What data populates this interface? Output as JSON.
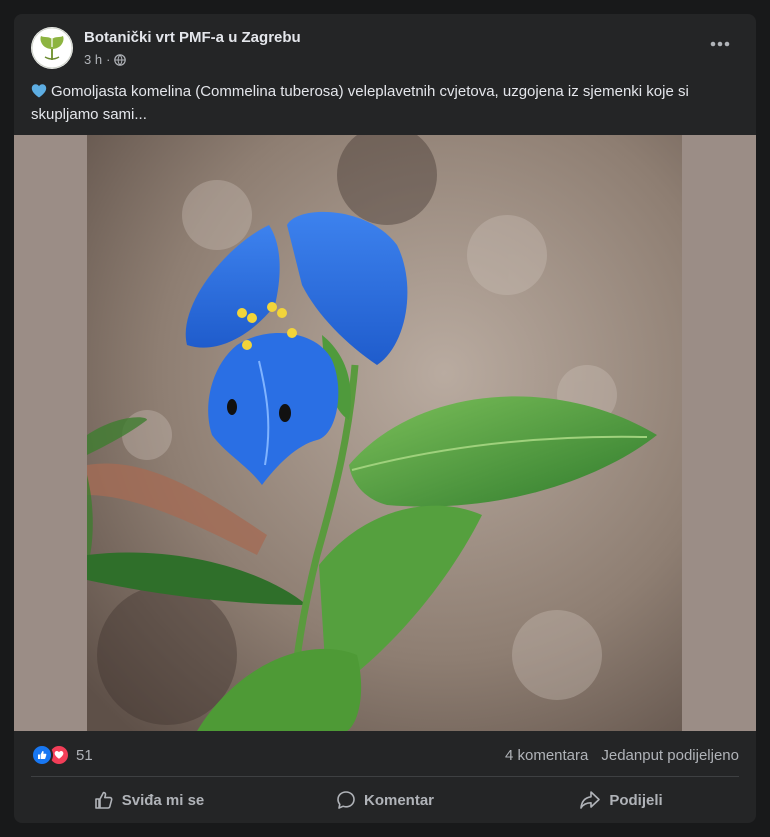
{
  "post": {
    "page_name": "Botanički vrt PMF-a u Zagrebu",
    "time": "3 h",
    "privacy_icon": "globe-icon",
    "more_icon": "more-dots-icon",
    "text_emoji_icon": "blue-heart-icon",
    "text": "Gomoljasta komelina (Commelina tuberosa) veleplavetnih cvjetova, uzgojena iz sjemenki koje si skupljamo sami...",
    "photo": {
      "subject": "blue commelina flower with green leaves on soil",
      "colors": {
        "petal": "#2f6fe0",
        "leaf": "#4f9a3c",
        "soil": "#8a7a6e",
        "side_bars": "#9b8d86"
      }
    }
  },
  "stats": {
    "reaction_icons": [
      "like-icon",
      "love-icon"
    ],
    "reaction_count": "51",
    "comments": "4 komentara",
    "shares": "Jedanput podijeljeno"
  },
  "actions": {
    "like_label": "Sviđa mi se",
    "comment_label": "Komentar",
    "share_label": "Podijeli"
  },
  "theme": {
    "background": "#18191a",
    "card": "#242526",
    "text_primary": "#e4e6eb",
    "text_secondary": "#b0b3b8",
    "like_blue": "#1877f2",
    "love_red": "#f33e58"
  }
}
